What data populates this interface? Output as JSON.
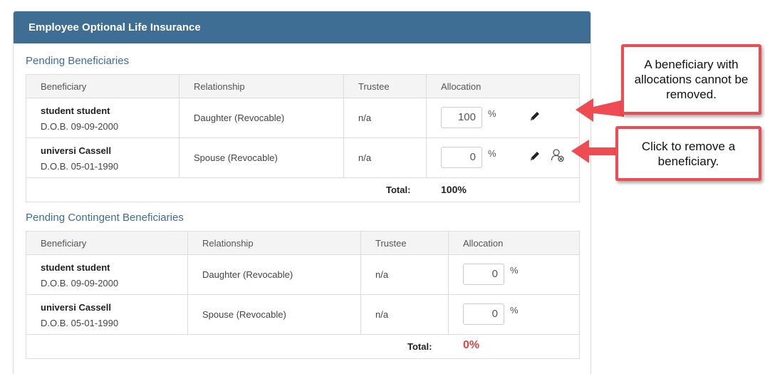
{
  "panel": {
    "title": "Employee Optional Life Insurance"
  },
  "pending": {
    "title": "Pending Beneficiaries",
    "columns": {
      "beneficiary": "Beneficiary",
      "relationship": "Relationship",
      "trustee": "Trustee",
      "allocation": "Allocation"
    },
    "rows": [
      {
        "name": "student student",
        "dob": "D.O.B. 09-09-2000",
        "relationship": "Daughter (Revocable)",
        "trustee": "n/a",
        "allocation": "100",
        "pct": "%"
      },
      {
        "name": "universi Cassell",
        "dob": "D.O.B. 05-01-1990",
        "relationship": "Spouse (Revocable)",
        "trustee": "n/a",
        "allocation": "0",
        "pct": "%"
      }
    ],
    "total_label": "Total:",
    "total_value": "100%"
  },
  "contingent": {
    "title": "Pending Contingent Beneficiaries",
    "columns": {
      "beneficiary": "Beneficiary",
      "relationship": "Relationship",
      "trustee": "Trustee",
      "allocation": "Allocation"
    },
    "rows": [
      {
        "name": "student student",
        "dob": "D.O.B. 09-09-2000",
        "relationship": "Daughter (Revocable)",
        "trustee": "n/a",
        "allocation": "0",
        "pct": "%"
      },
      {
        "name": "universi Cassell",
        "dob": "D.O.B. 05-01-1990",
        "relationship": "Spouse (Revocable)",
        "trustee": "n/a",
        "allocation": "0",
        "pct": "%"
      }
    ],
    "total_label": "Total:",
    "total_value": "0%"
  },
  "callouts": {
    "allocation_note": "A beneficiary with allocations cannot be removed.",
    "remove_note": "Click to remove a beneficiary."
  },
  "icons": {
    "edit": "pencil-icon",
    "remove": "remove-beneficiary-icon"
  },
  "colors": {
    "header": "#3f6e95",
    "section_title": "#3f6e95",
    "callout_border": "#ee4b52",
    "zero_total": "#e04444"
  }
}
